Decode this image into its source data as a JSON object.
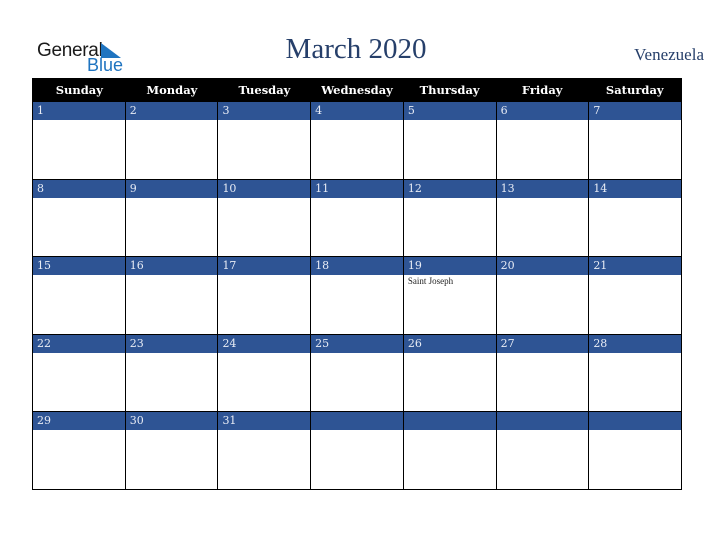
{
  "logo": {
    "word1": "General",
    "word2": "Blue",
    "icon": "triangle-flag-icon"
  },
  "header": {
    "title": "March 2020",
    "country": "Venezuela"
  },
  "colors": {
    "accent": "#2e5494",
    "header_bg": "#000000",
    "title": "#263f6a",
    "logo_blue": "#1f74c0"
  },
  "weekdays": [
    "Sunday",
    "Monday",
    "Tuesday",
    "Wednesday",
    "Thursday",
    "Friday",
    "Saturday"
  ],
  "weeks": [
    [
      {
        "day": "1",
        "event": ""
      },
      {
        "day": "2",
        "event": ""
      },
      {
        "day": "3",
        "event": ""
      },
      {
        "day": "4",
        "event": ""
      },
      {
        "day": "5",
        "event": ""
      },
      {
        "day": "6",
        "event": ""
      },
      {
        "day": "7",
        "event": ""
      }
    ],
    [
      {
        "day": "8",
        "event": ""
      },
      {
        "day": "9",
        "event": ""
      },
      {
        "day": "10",
        "event": ""
      },
      {
        "day": "11",
        "event": ""
      },
      {
        "day": "12",
        "event": ""
      },
      {
        "day": "13",
        "event": ""
      },
      {
        "day": "14",
        "event": ""
      }
    ],
    [
      {
        "day": "15",
        "event": ""
      },
      {
        "day": "16",
        "event": ""
      },
      {
        "day": "17",
        "event": ""
      },
      {
        "day": "18",
        "event": ""
      },
      {
        "day": "19",
        "event": "Saint Joseph"
      },
      {
        "day": "20",
        "event": ""
      },
      {
        "day": "21",
        "event": ""
      }
    ],
    [
      {
        "day": "22",
        "event": ""
      },
      {
        "day": "23",
        "event": ""
      },
      {
        "day": "24",
        "event": ""
      },
      {
        "day": "25",
        "event": ""
      },
      {
        "day": "26",
        "event": ""
      },
      {
        "day": "27",
        "event": ""
      },
      {
        "day": "28",
        "event": ""
      }
    ],
    [
      {
        "day": "29",
        "event": ""
      },
      {
        "day": "30",
        "event": ""
      },
      {
        "day": "31",
        "event": ""
      },
      {
        "day": "",
        "event": ""
      },
      {
        "day": "",
        "event": ""
      },
      {
        "day": "",
        "event": ""
      },
      {
        "day": "",
        "event": ""
      }
    ]
  ]
}
